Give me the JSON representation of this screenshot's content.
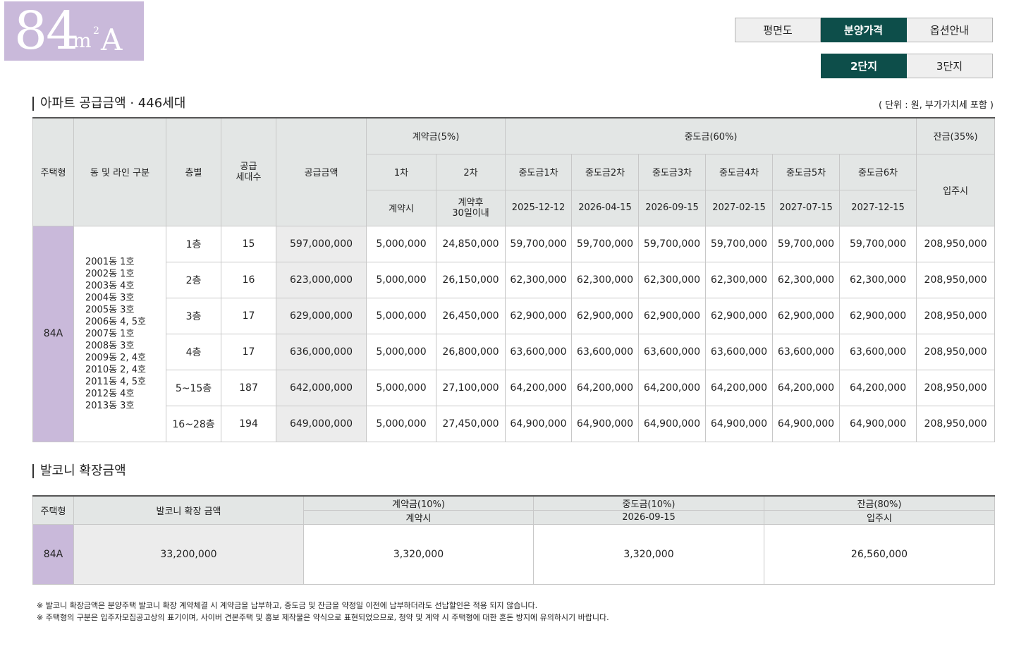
{
  "badge": {
    "number": "84",
    "unit": "m",
    "superscript": "2",
    "type": "A"
  },
  "tabs_main": [
    {
      "label": "평면도",
      "active": false
    },
    {
      "label": "분양가격",
      "active": true
    },
    {
      "label": "옵션안내",
      "active": false
    }
  ],
  "tabs_complex": [
    {
      "label": "2단지",
      "active": true
    },
    {
      "label": "3단지",
      "active": false
    }
  ],
  "supply": {
    "title": "아파트 공급금액 · 446세대",
    "unit_note": "( 단위 : 원, 부가가치세 포함 )",
    "headers": {
      "house_type": "주택형",
      "dong_line": "동 및 라인 구분",
      "floor": "층별",
      "units": "공급\n세대수",
      "price": "공급금액",
      "contract": "계약금(5%)",
      "middle": "중도금(60%)",
      "balance": "잔금(35%)",
      "c1": "1차",
      "c2": "2차",
      "m1": "중도금1차",
      "m2": "중도금2차",
      "m3": "중도금3차",
      "m4": "중도금4차",
      "m5": "중도금5차",
      "m6": "중도금6차",
      "move_in": "입주시",
      "c1_when": "계약시",
      "c2_when": "계약후\n30일이내",
      "m1_date": "2025-12-12",
      "m2_date": "2026-04-15",
      "m3_date": "2026-09-15",
      "m4_date": "2027-02-15",
      "m5_date": "2027-07-15",
      "m6_date": "2027-12-15"
    },
    "type": "84A",
    "lines": "2001동 1호\n2002동 1호\n2003동 4호\n2004동 3호\n2005동 3호\n2006동 4, 5호\n2007동 1호\n2008동 3호\n2009동 2, 4호\n2010동 2, 4호\n2011동 4, 5호\n2012동 4호\n2013동 3호",
    "rows": [
      {
        "floor": "1층",
        "units": "15",
        "price": "597,000,000",
        "c1": "5,000,000",
        "c2": "24,850,000",
        "m1": "59,700,000",
        "m2": "59,700,000",
        "m3": "59,700,000",
        "m4": "59,700,000",
        "m5": "59,700,000",
        "m6": "59,700,000",
        "balance": "208,950,000"
      },
      {
        "floor": "2층",
        "units": "16",
        "price": "623,000,000",
        "c1": "5,000,000",
        "c2": "26,150,000",
        "m1": "62,300,000",
        "m2": "62,300,000",
        "m3": "62,300,000",
        "m4": "62,300,000",
        "m5": "62,300,000",
        "m6": "62,300,000",
        "balance": "208,950,000"
      },
      {
        "floor": "3층",
        "units": "17",
        "price": "629,000,000",
        "c1": "5,000,000",
        "c2": "26,450,000",
        "m1": "62,900,000",
        "m2": "62,900,000",
        "m3": "62,900,000",
        "m4": "62,900,000",
        "m5": "62,900,000",
        "m6": "62,900,000",
        "balance": "208,950,000"
      },
      {
        "floor": "4층",
        "units": "17",
        "price": "636,000,000",
        "c1": "5,000,000",
        "c2": "26,800,000",
        "m1": "63,600,000",
        "m2": "63,600,000",
        "m3": "63,600,000",
        "m4": "63,600,000",
        "m5": "63,600,000",
        "m6": "63,600,000",
        "balance": "208,950,000"
      },
      {
        "floor": "5~15층",
        "units": "187",
        "price": "642,000,000",
        "c1": "5,000,000",
        "c2": "27,100,000",
        "m1": "64,200,000",
        "m2": "64,200,000",
        "m3": "64,200,000",
        "m4": "64,200,000",
        "m5": "64,200,000",
        "m6": "64,200,000",
        "balance": "208,950,000"
      },
      {
        "floor": "16~28층",
        "units": "194",
        "price": "649,000,000",
        "c1": "5,000,000",
        "c2": "27,450,000",
        "m1": "64,900,000",
        "m2": "64,900,000",
        "m3": "64,900,000",
        "m4": "64,900,000",
        "m5": "64,900,000",
        "m6": "64,900,000",
        "balance": "208,950,000"
      }
    ]
  },
  "balcony": {
    "title": "발코니 확장금액",
    "headers": {
      "house_type": "주택형",
      "amount": "발코니 확장 금액",
      "contract": "계약금(10%)",
      "contract_when": "계약시",
      "middle": "중도금(10%)",
      "middle_date": "2026-09-15",
      "balance": "잔금(80%)",
      "balance_when": "입주시"
    },
    "row": {
      "type": "84A",
      "amount": "33,200,000",
      "contract": "3,320,000",
      "middle": "3,320,000",
      "balance": "26,560,000"
    }
  },
  "notes": [
    "※ 발코니 확장금액은 분양주택 발코니 확장 계약체결 시 계약금을 납부하고, 중도금 및 잔금을 약정일 이전에 납부하더라도 선납할인은 적용 되지 않습니다.",
    "※ 주택형의 구분은 입주자모집공고상의 표기이며, 사이버 견본주택 및 홍보 제작물은 약식으로 표현되었으므로, 청약 및 계약 시 주택형에 대한 혼돈 방지에 유의하시기 바랍니다."
  ]
}
